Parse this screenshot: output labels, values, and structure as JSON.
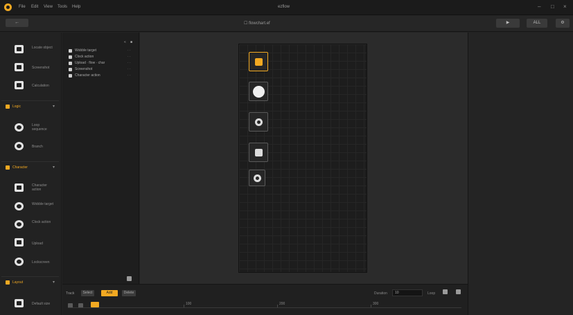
{
  "app": {
    "title": "ezflow",
    "menu": [
      "File",
      "Edit",
      "View",
      "Tools",
      "Help"
    ]
  },
  "toolbar": {
    "back_label": "←",
    "project_name": "☐ flowchart.ef",
    "run_label": "▶",
    "export_label": "ALL",
    "settings_label": "⚙"
  },
  "sidebar": {
    "top_items": [
      {
        "label": "Locate object",
        "icon": "locate-icon"
      },
      {
        "label": "Screenshot",
        "icon": "screenshot-icon"
      },
      {
        "label": "Calculation",
        "icon": "calculator-icon"
      }
    ],
    "sections": [
      {
        "title": "Logic",
        "items": [
          {
            "label": "Loop sequence",
            "icon": "loop-icon"
          },
          {
            "label": "Branch",
            "icon": "branch-icon"
          }
        ]
      },
      {
        "title": "Character",
        "items": [
          {
            "label": "Character action",
            "icon": "character-icon"
          },
          {
            "label": "Wobble target",
            "icon": "wobble-icon"
          },
          {
            "label": "Clock action",
            "icon": "clock-icon"
          },
          {
            "label": "Upload",
            "icon": "upload-icon"
          },
          {
            "label": "Lockscreen",
            "icon": "lock-icon"
          }
        ]
      },
      {
        "title": "Layout",
        "items": [
          {
            "label": "Default size",
            "icon": "size-icon"
          }
        ]
      }
    ]
  },
  "layers": {
    "items": [
      {
        "label": "Wobble target",
        "icon": "wobble-icon"
      },
      {
        "label": "Clock action",
        "icon": "clock-icon"
      },
      {
        "label": "Upload · flow · char",
        "icon": "upload-icon"
      },
      {
        "label": "Screenshot",
        "icon": "screenshot-icon"
      },
      {
        "label": "Character action",
        "icon": "character-icon"
      }
    ]
  },
  "canvas": {
    "nodes": [
      {
        "name": "character-node",
        "icon": "character-icon",
        "selected": true
      },
      {
        "name": "circle-node",
        "icon": "circle-icon",
        "selected": false
      },
      {
        "name": "clock-node",
        "icon": "clock-icon",
        "selected": false
      },
      {
        "name": "upload-node",
        "icon": "upload-icon",
        "selected": false
      },
      {
        "name": "lock-node",
        "icon": "lock-icon",
        "selected": false
      }
    ]
  },
  "timeline": {
    "label": "Track",
    "buttons": [
      "Select",
      "Add",
      "Delete"
    ],
    "active_button": "Add",
    "ticks": [
      "100",
      "200",
      "300"
    ],
    "duration_label": "Duration",
    "duration_value": "10",
    "loop_label": "Loop"
  },
  "colors": {
    "accent": "#f2a922",
    "background": "#232323",
    "panel": "#1e1e1e",
    "canvas_bg": "#1d1d1d"
  }
}
